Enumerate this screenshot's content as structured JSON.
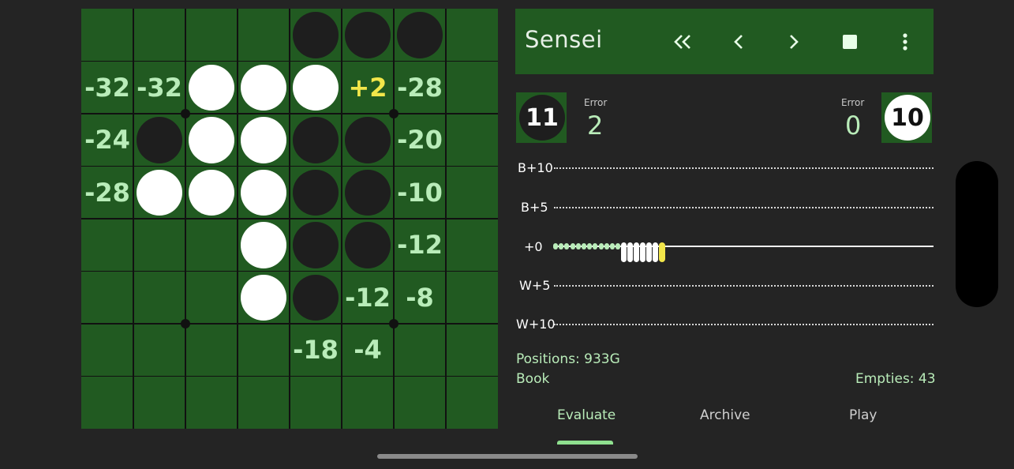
{
  "header": {
    "title": "Sensei",
    "icons": [
      "double-chevron-left-icon",
      "chevron-left-icon",
      "chevron-right-icon",
      "stop-icon",
      "more-vert-icon"
    ]
  },
  "colors": {
    "board": "#215a21",
    "eval_normal": "#b9ecb9",
    "eval_best": "#f2e64a",
    "black_disc": "#1e1e1e",
    "white_disc": "#ffffff"
  },
  "board": {
    "size": 8,
    "cells": [
      [
        "",
        "",
        "",
        "",
        "B",
        "B",
        "B",
        ""
      ],
      [
        "-32",
        "-32",
        "W",
        "W",
        "W",
        "+2",
        "-28",
        ""
      ],
      [
        "-24",
        "B",
        "W",
        "W",
        "B",
        "B",
        "-20",
        ""
      ],
      [
        "-28",
        "W",
        "W",
        "W",
        "B",
        "B",
        "-10",
        ""
      ],
      [
        "",
        "",
        "",
        "W",
        "B",
        "B",
        "-12",
        ""
      ],
      [
        "",
        "",
        "",
        "W",
        "B",
        "-12",
        "-8",
        ""
      ],
      [
        "",
        "",
        "",
        "",
        "-18",
        "-4",
        "",
        ""
      ],
      [
        "",
        "",
        "",
        "",
        "",
        "",
        "",
        ""
      ]
    ],
    "best_move": "+2"
  },
  "score": {
    "black": {
      "count": "11",
      "error_label": "Error",
      "error": "2"
    },
    "white": {
      "count": "10",
      "error_label": "Error",
      "error": "0"
    }
  },
  "graph": {
    "labels": [
      "B+10",
      "B+5",
      "+0",
      "W+5",
      "W+10"
    ],
    "green_moves": 12,
    "white_moves": 6,
    "current_move": 1
  },
  "info": {
    "positions": "Positions: 933G",
    "book": "Book",
    "empties": "Empties: 43"
  },
  "tabs": [
    {
      "label": "Evaluate",
      "active": true
    },
    {
      "label": "Archive",
      "active": false
    },
    {
      "label": "Play",
      "active": false
    }
  ]
}
